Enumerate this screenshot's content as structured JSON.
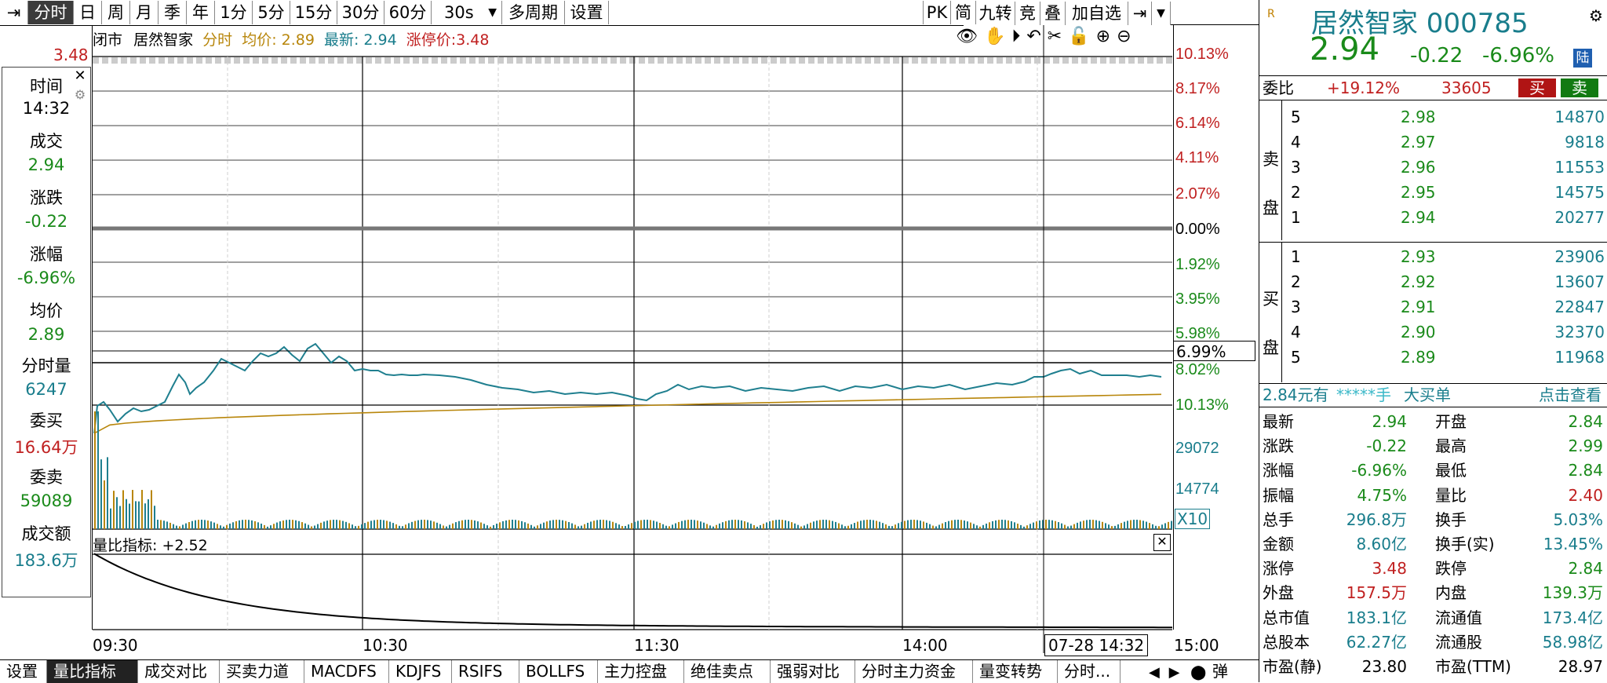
{
  "toolbar": {
    "back_icon": "exit-arrow-icon",
    "periods": [
      "分时",
      "日",
      "周",
      "月",
      "季",
      "年",
      "1分",
      "5分",
      "15分",
      "30分",
      "60分",
      "30s"
    ],
    "multi_period": "多周期",
    "settings": "设置",
    "right_tools": [
      "PK",
      "简",
      "九转",
      "竞",
      "叠",
      "加自选"
    ]
  },
  "chart_header": {
    "status": "闭市",
    "stock_name": "居然智家",
    "mode": "分时",
    "avg_label": "均价: 2.89",
    "latest_label": "最新: 2.94",
    "limit_label": "涨停价:3.48",
    "top_price": "3.48"
  },
  "right_axis": [
    "10.13%",
    "8.17%",
    "6.14%",
    "4.11%",
    "2.07%",
    "0.00%",
    "1.92%",
    "3.95%",
    "5.98%",
    "8.02%",
    "10.13%"
  ],
  "crosshair_label": "6.99%",
  "volume_axis": [
    "29072",
    "14774"
  ],
  "volume_scale": "X10",
  "indicator": {
    "label": "量比指标: +2.52"
  },
  "time_axis": [
    "09:30",
    "10:30",
    "11:30",
    "14:00",
    "15:00"
  ],
  "crosshair_time": "07-28 14:32",
  "infobox": {
    "time_label": "时间",
    "time_val": "14:32",
    "deal_label": "成交",
    "deal_val": "2.94",
    "change_label": "涨跌",
    "change_val": "-0.22",
    "pct_label": "涨幅",
    "pct_val": "-6.96%",
    "avg_label": "均价",
    "avg_val": "2.89",
    "vol_label": "分时量",
    "vol_val": "6247",
    "bid_label": "委买",
    "bid_val": "16.64万",
    "ask_label": "委卖",
    "ask_val": "59089",
    "amount_label": "成交额",
    "amount_val": "183.6万"
  },
  "quote": {
    "badge": "R",
    "name_code": "居然智家 000785",
    "price": "2.94",
    "change": "-0.22",
    "pct": "-6.96%",
    "tag": "陆",
    "ratio_label": "委比",
    "ratio_val": "+19.12%",
    "ratio_diff": "33605",
    "buy_btn": "买",
    "sell_btn": "卖",
    "sell_side_label": "卖盘",
    "buy_side_label": "买盘"
  },
  "asks": [
    {
      "level": "5",
      "price": "2.98",
      "vol": "14870"
    },
    {
      "level": "4",
      "price": "2.97",
      "vol": "9818"
    },
    {
      "level": "3",
      "price": "2.96",
      "vol": "11553"
    },
    {
      "level": "2",
      "price": "2.95",
      "vol": "14575"
    },
    {
      "level": "1",
      "price": "2.94",
      "vol": "20277"
    }
  ],
  "bids": [
    {
      "level": "1",
      "price": "2.93",
      "vol": "23906"
    },
    {
      "level": "2",
      "price": "2.92",
      "vol": "13607"
    },
    {
      "level": "3",
      "price": "2.91",
      "vol": "22847"
    },
    {
      "level": "4",
      "price": "2.90",
      "vol": "32370"
    },
    {
      "level": "5",
      "price": "2.89",
      "vol": "11968"
    }
  ],
  "bigorder": {
    "a": "2.84元有",
    "b": "*****手",
    "c": "大买单",
    "d": "点击查看"
  },
  "stats": [
    {
      "l1": "最新",
      "v1": "2.94",
      "l2": "开盘",
      "v2": "2.84",
      "c1": "green",
      "c2": "green"
    },
    {
      "l1": "涨跌",
      "v1": "-0.22",
      "l2": "最高",
      "v2": "2.99",
      "c1": "green",
      "c2": "green"
    },
    {
      "l1": "涨幅",
      "v1": "-6.96%",
      "l2": "最低",
      "v2": "2.84",
      "c1": "green",
      "c2": "green"
    },
    {
      "l1": "振幅",
      "v1": "4.75%",
      "l2": "量比",
      "v2": "2.40",
      "c1": "green",
      "c2": "red"
    },
    {
      "l1": "总手",
      "v1": "296.8万",
      "l2": "换手",
      "v2": "5.03%",
      "c1": "teal",
      "c2": "teal"
    },
    {
      "l1": "金额",
      "v1": "8.60亿",
      "l2": "换手(实)",
      "v2": "13.45%",
      "c1": "teal",
      "c2": "teal"
    },
    {
      "l1": "涨停",
      "v1": "3.48",
      "l2": "跌停",
      "v2": "2.84",
      "c1": "red",
      "c2": "green"
    },
    {
      "l1": "外盘",
      "v1": "157.5万",
      "l2": "内盘",
      "v2": "139.3万",
      "c1": "red",
      "c2": "green"
    },
    {
      "l1": "总市值",
      "v1": "183.1亿",
      "l2": "流通值",
      "v2": "173.4亿",
      "c1": "teal",
      "c2": "teal"
    },
    {
      "l1": "总股本",
      "v1": "62.27亿",
      "l2": "流通股",
      "v2": "58.98亿",
      "c1": "teal",
      "c2": "teal"
    },
    {
      "l1": "市盈(静)",
      "v1": "23.80",
      "l2": "市盈(TTM)",
      "v2": "28.97",
      "c1": "dark",
      "c2": "dark"
    }
  ],
  "bottom_tabs": [
    "设置",
    "量比指标",
    "成交对比",
    "买卖力道",
    "MACDFS",
    "KDJFS",
    "RSIFS",
    "BOLLFS",
    "主力控盘",
    "绝佳卖点",
    "强弱对比",
    "分时主力资金",
    "量变转势",
    "分时..."
  ],
  "bottom_right": "弹",
  "colors": {
    "price_line": "#1f7f8f",
    "avg_line": "#b8860b",
    "up": "#c02020",
    "down": "#1a8a1a"
  }
}
